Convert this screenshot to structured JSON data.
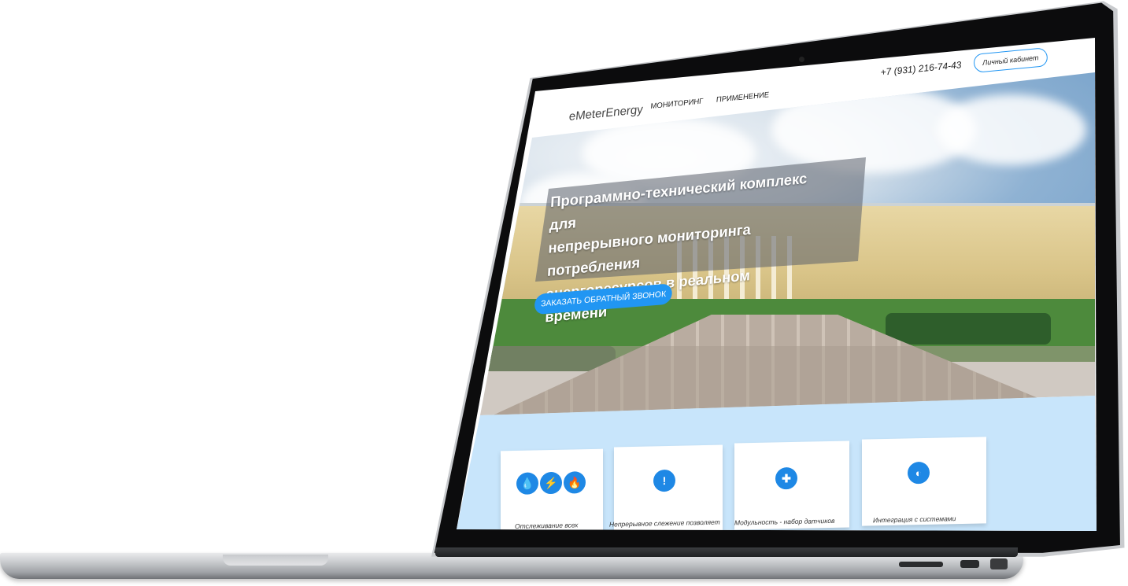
{
  "site": {
    "logo": "eMeterEnergy",
    "nav": [
      "МОНИТОРИНГ",
      "ПРИМЕНЕНИЕ"
    ],
    "phone": "+7 (931) 216-74-43",
    "account_button": "Личный кабинет"
  },
  "hero": {
    "headline_lines": [
      "Программно-технический комплекс для",
      "непрерывного мониторинга потребления",
      "энергоресурсов в реальном времени"
    ],
    "cta_label": "ЗАКАЗАТЬ ОБРАТНЫЙ ЗВОНОК"
  },
  "features": [
    {
      "icon": "resources-icons",
      "text": "Отслеживание всех"
    },
    {
      "icon": "exclamation-icon",
      "text": "Непрерывное слежение позволяет"
    },
    {
      "icon": "puzzle-icon",
      "text": "Модульность - набор датчиков"
    },
    {
      "icon": "integration-icon",
      "text": "Интеграция с системами"
    }
  ],
  "colors": {
    "accent": "#2196f3",
    "features_bg": "#c8e5fb"
  }
}
